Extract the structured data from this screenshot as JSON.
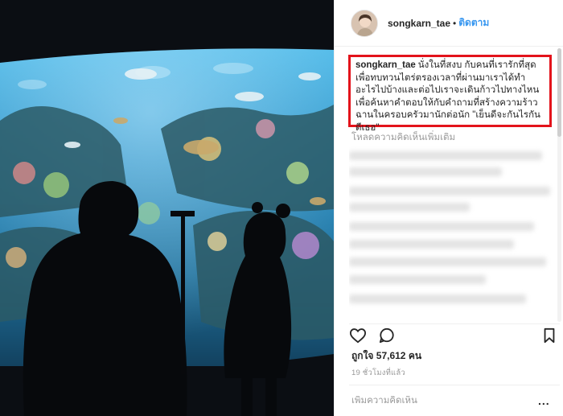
{
  "post": {
    "username": "songkarn_tae",
    "separator": "•",
    "follow_label": "ติดตาม",
    "caption_user": "songkarn_tae",
    "caption_text": "นั่งในที่สงบ กับคนที่เรารักที่สุด เพื่อทบทวนไตร่ตรองเวลาที่ผ่านมาเราได้ทำอะไรไปบ้างและต่อไปเราจะเดินก้าวไปทางไหน เพื่อค้นหาคำตอบให้กับคำถามที่สร้างความร้าวฉานในครอบครัวมานักต่อนัก \"เย็นดีจะกันไรกันดีเธอ\"",
    "load_more_comments": "โหลดความคิดเห็นเพิ่มเติม",
    "likes_prefix": "ถูกใจ",
    "likes_count": "57,612",
    "likes_suffix": "คน",
    "timestamp": "19 ชั่วโมงที่แล้ว",
    "comment_placeholder": "เพิ่มความคิดเห็น",
    "more_options": "..."
  },
  "colors": {
    "accent": "#3897f0",
    "highlight_border": "#e3131b",
    "muted_text": "#999999"
  },
  "icons": {
    "like": "heart-icon",
    "comment": "comment-bubble-icon",
    "save": "bookmark-icon"
  }
}
